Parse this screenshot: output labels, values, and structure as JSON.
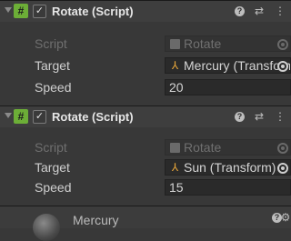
{
  "components": [
    {
      "title": "Rotate (Script)",
      "enabled_mark": "✓",
      "rows": [
        {
          "label": "Script",
          "value": "Rotate",
          "kind": "script"
        },
        {
          "label": "Target",
          "value": "Mercury (Transform)",
          "kind": "object"
        },
        {
          "label": "Speed",
          "value": "20",
          "kind": "number"
        }
      ]
    },
    {
      "title": "Rotate (Script)",
      "enabled_mark": "✓",
      "rows": [
        {
          "label": "Script",
          "value": "Rotate",
          "kind": "script"
        },
        {
          "label": "Target",
          "value": "Sun (Transform)",
          "kind": "object"
        },
        {
          "label": "Speed",
          "value": "15",
          "kind": "number"
        }
      ]
    }
  ],
  "bottom": {
    "label": "Mercury"
  },
  "icons": {
    "script": "#",
    "help": "?",
    "presets": "⇄",
    "menu": "⋮",
    "transform": "⅄",
    "gear": "⚙"
  },
  "colors": {
    "background": "#383838",
    "script_icon": "#6cae37",
    "transform_icon": "#e5a53a"
  }
}
